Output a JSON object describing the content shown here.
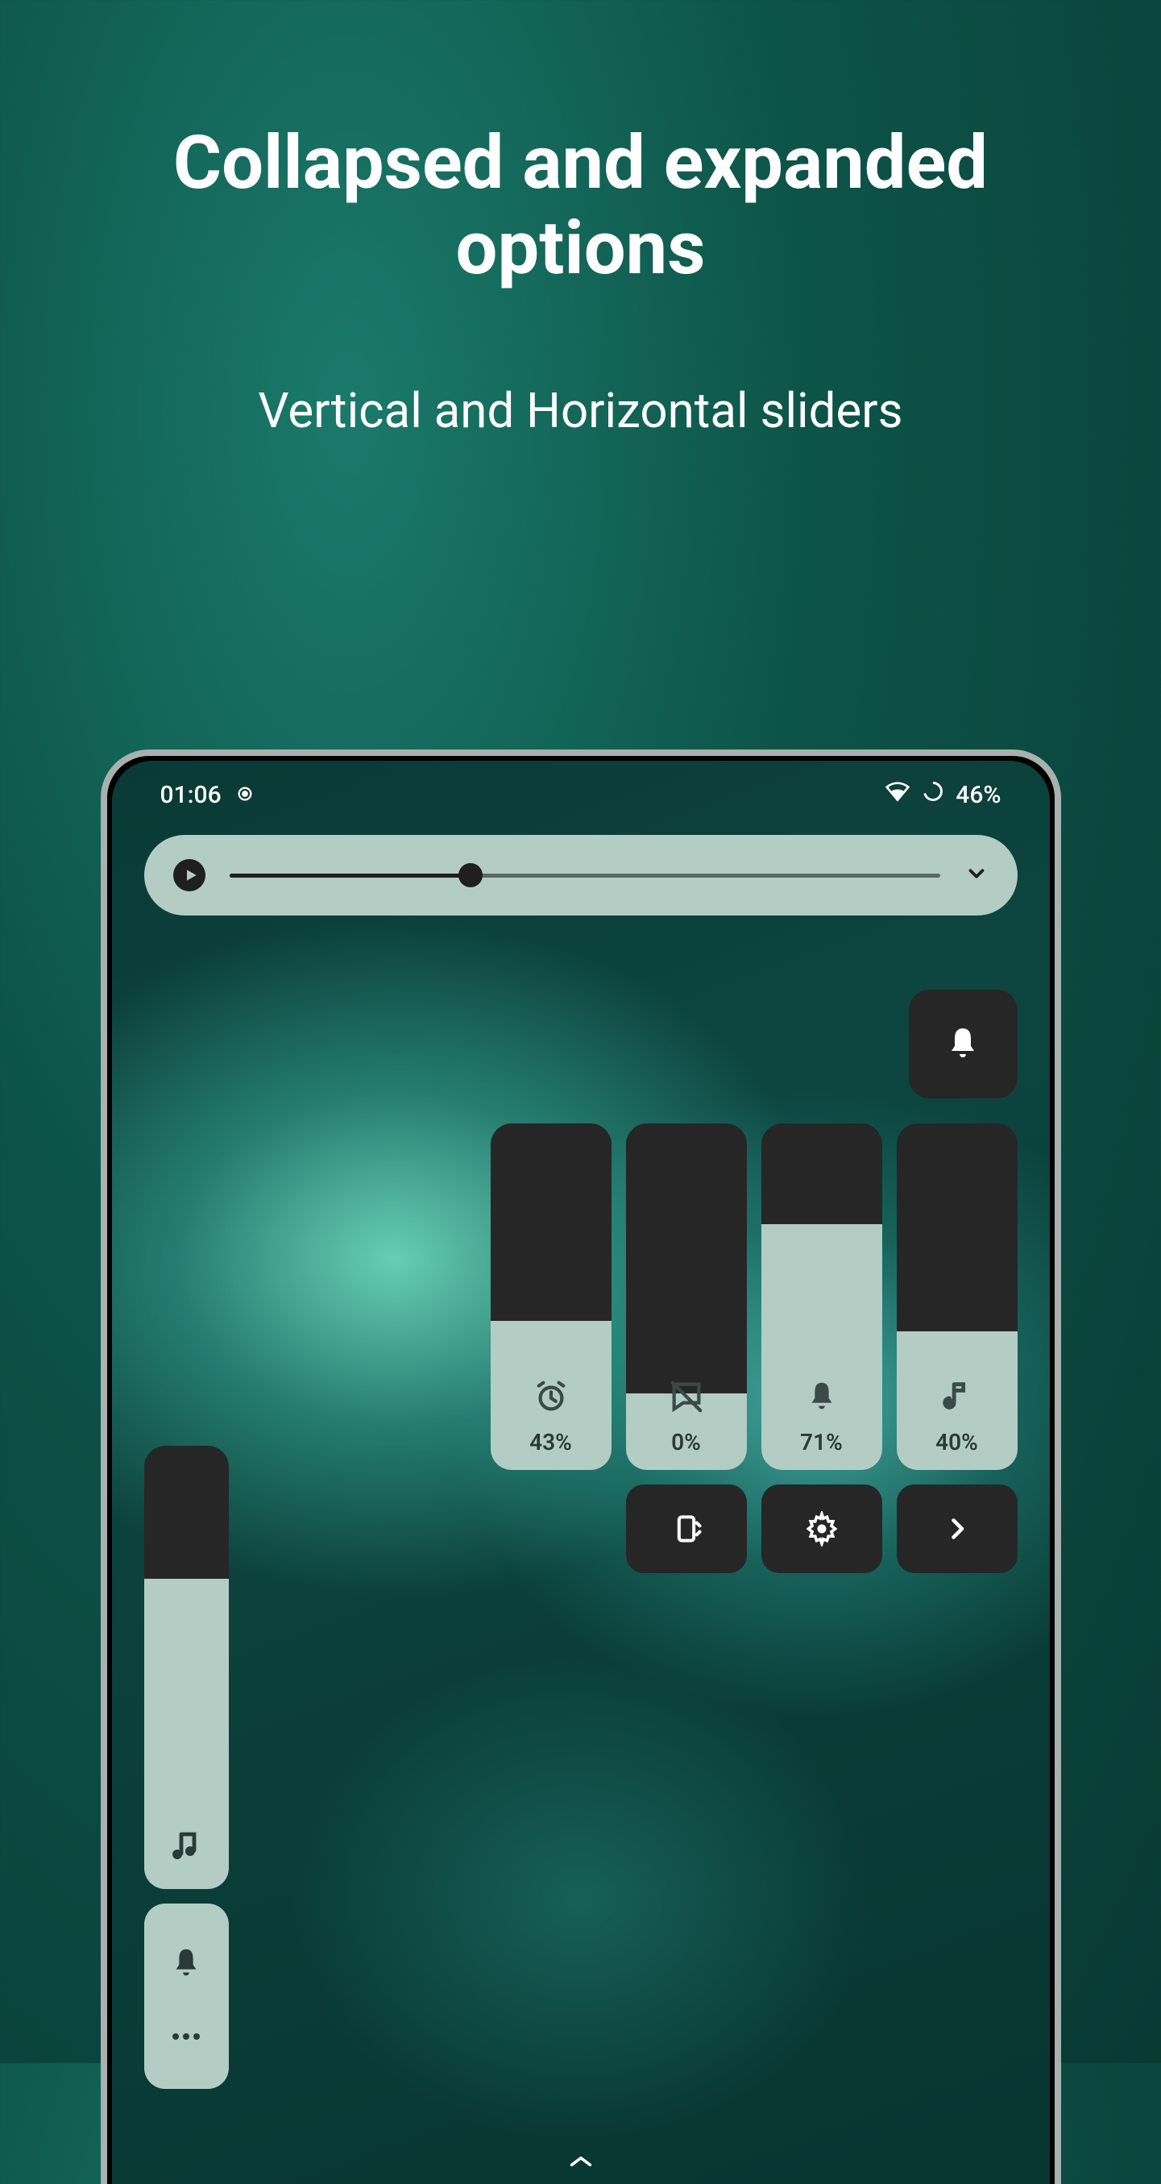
{
  "promo": {
    "title": "Collapsed and expanded options",
    "subtitle": "Vertical and Horizontal sliders"
  },
  "status": {
    "time": "01:06",
    "battery": "46%"
  },
  "media": {
    "progress_pct": 34
  },
  "sliders": [
    {
      "name": "alarm",
      "pct": 43,
      "label": "43%",
      "icon": "alarm"
    },
    {
      "name": "notification",
      "pct": 0,
      "label": "0%",
      "icon": "chat-off"
    },
    {
      "name": "ring",
      "pct": 71,
      "label": "71%",
      "icon": "bell"
    },
    {
      "name": "media",
      "pct": 40,
      "label": "40%",
      "icon": "note"
    }
  ],
  "collapsed": {
    "pct": 70
  }
}
